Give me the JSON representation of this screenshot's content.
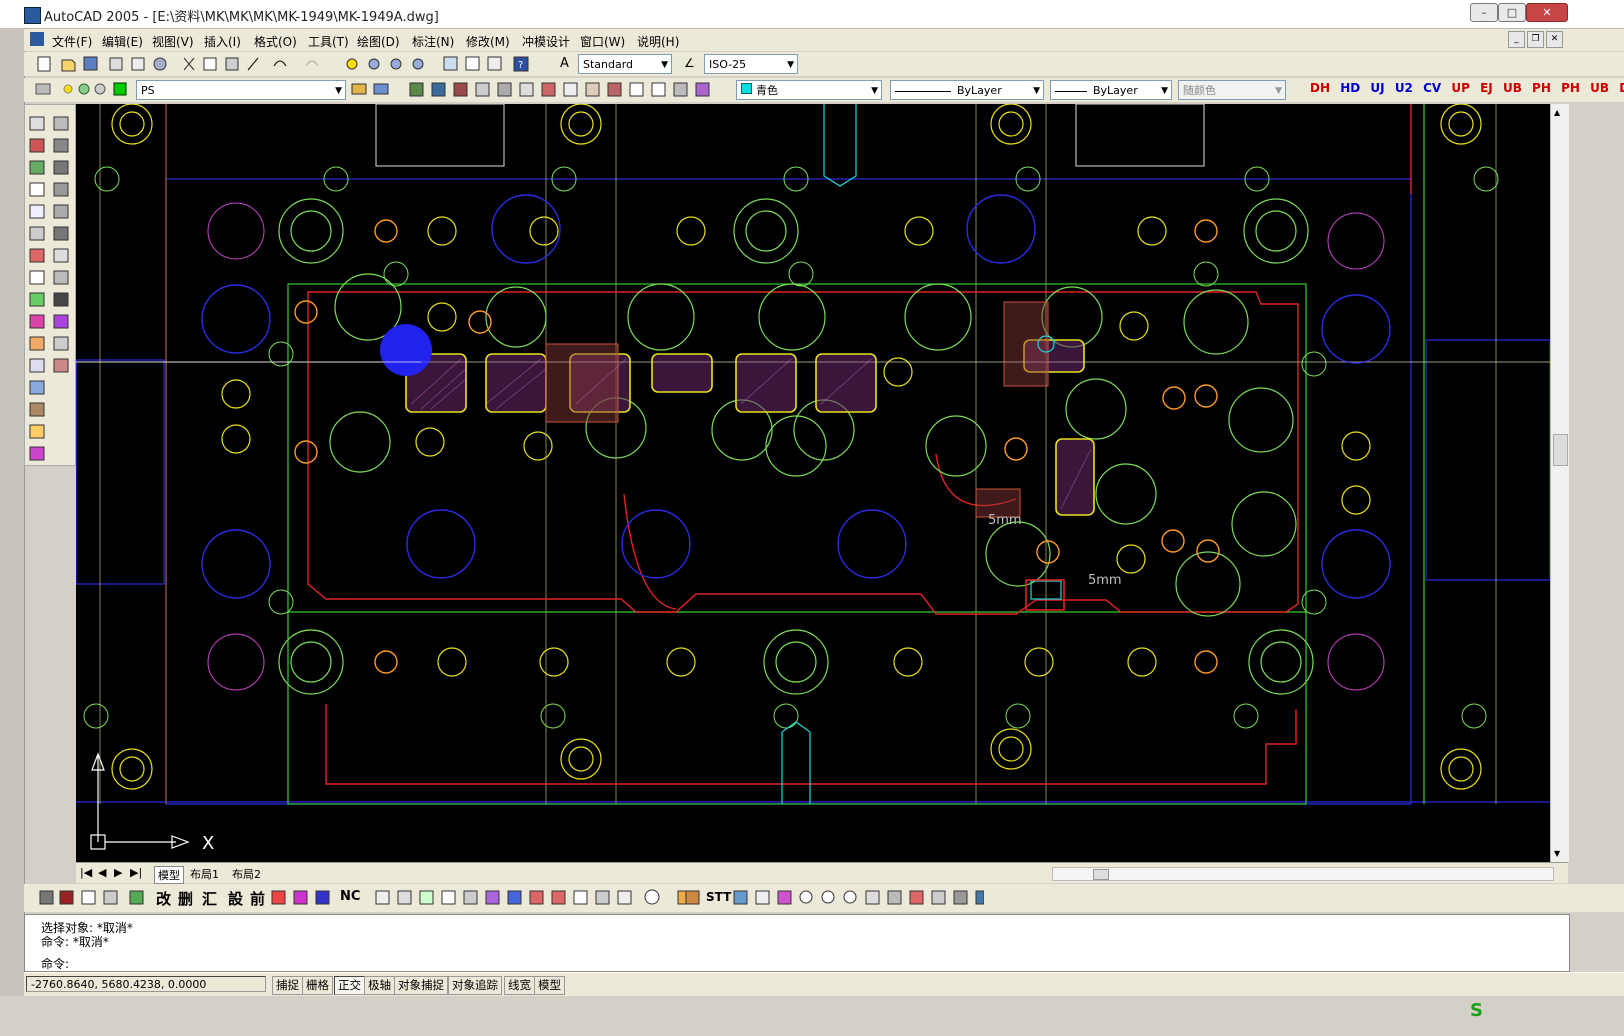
{
  "window": {
    "title": "AutoCAD 2005 - [E:\\资料\\MK\\MK\\MK\\MK-1949\\MK-1949A.dwg]"
  },
  "menu": [
    "文件(F)",
    "编辑(E)",
    "视图(V)",
    "插入(I)",
    "格式(O)",
    "工具(T)",
    "绘图(D)",
    "标注(N)",
    "修改(M)",
    "冲模设计",
    "窗口(W)",
    "说明(H)"
  ],
  "toolbar": {
    "text_style": "Standard",
    "dim_style": "ISO-25",
    "layer": "PS",
    "color": "青色",
    "linetype": "ByLayer",
    "lineweight": "ByLayer",
    "plotstyle": "随颜色",
    "right_buttons": [
      "DH",
      "HD",
      "UJ",
      "U2",
      "CV",
      "UP",
      "EJ",
      "UB",
      "PH",
      "PH",
      "UB",
      "DD"
    ]
  },
  "canvas": {
    "annotations": [
      "5mm",
      "5mm"
    ],
    "ucs_x_label": "X"
  },
  "tabs": {
    "nav": [
      "|◀",
      "◀",
      "▶",
      "▶|"
    ],
    "items": [
      "模型",
      "布局1",
      "布局2"
    ]
  },
  "draw_toolbar_text": [
    "改",
    "删",
    "汇",
    "設",
    "前",
    "NC",
    "STT"
  ],
  "command": {
    "lines": [
      "选择对象: *取消*",
      "命令: *取消*",
      "命令:"
    ]
  },
  "status": {
    "coords": "-2760.8640,  5680.4238,  0.0000",
    "buttons": [
      "捕捉",
      "栅格",
      "正交",
      "极轴",
      "对象捕捉",
      "对象追踪",
      "线宽",
      "模型"
    ],
    "active": [
      "正交"
    ]
  },
  "colors": {
    "accent_red": "#e32222",
    "cad_green": "#33cc33",
    "cad_yellow": "#e8e020",
    "cad_blue": "#2b2bdf",
    "cad_magenta": "#cc44cc"
  }
}
